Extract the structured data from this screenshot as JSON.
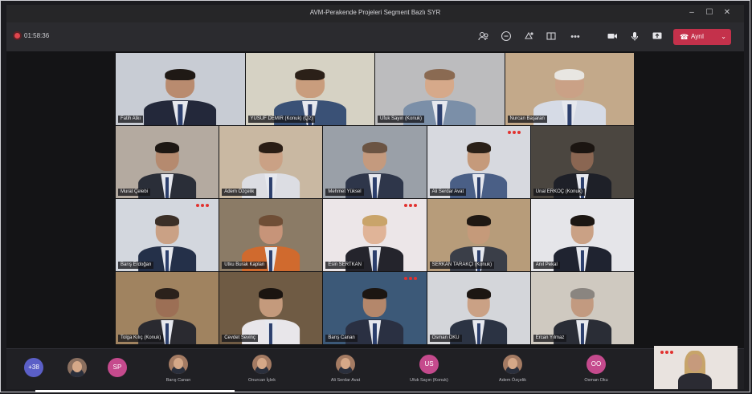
{
  "window": {
    "title": "AVM-Perakende Projeleri Segment Bazlı SYR",
    "controls": [
      "–",
      "☐",
      "✕"
    ]
  },
  "toolbar": {
    "timer": "01:58:36",
    "icons": [
      "participants-icon",
      "chat-icon",
      "reactions-icon",
      "rooms-icon",
      "more-icon",
      "camera-icon",
      "mic-icon",
      "share-icon"
    ],
    "leave_label": "Ayrıl"
  },
  "colors": {
    "leave_red": "#c4314b",
    "recording_red": "#e0464e",
    "overflow_purple": "#5b5fc7",
    "brand_red": "#e2322f"
  },
  "grid": {
    "tiles": [
      {
        "name": "Fatih Atkı",
        "bg": "#c8ccd4",
        "skin": "#b98b6f",
        "hair": "#1f1915",
        "suit": "#23283a"
      },
      {
        "name": "YUSUF DEMİR (Konuk) (Q2)",
        "bg": "#d6d2c4",
        "skin": "#c99d7d",
        "hair": "#2b2018",
        "suit": "#3a5176"
      },
      {
        "name": "Ufuk Sayın (Konuk)",
        "bg": "#bcbcbe",
        "skin": "#d6a98a",
        "hair": "#8a6a52",
        "suit": "#7b8fa8"
      },
      {
        "name": "Nurcan Başaran",
        "bg": "#c3a98a",
        "skin": "#caa186",
        "hair": "#e8e6e2",
        "suit": "#d6dbe6"
      },
      {
        "name": "Murat Çelebi",
        "bg": "#b4aaa0",
        "skin": "#b58a6f",
        "hair": "#1d1713",
        "suit": "#2a2e38"
      },
      {
        "name": "Adem Özçelik",
        "bg": "#c9b8a2",
        "skin": "#caa185",
        "hair": "#2a1d15",
        "suit": "#dcdde3"
      },
      {
        "name": "Mehmet Yüksel",
        "bg": "#9aa0a8",
        "skin": "#c49a7e",
        "hair": "#6b5443",
        "suit": "#2e364a"
      },
      {
        "name": "Ali Serdar Avat",
        "bg": "#d7d9df",
        "skin": "#c59a7b",
        "hair": "#2a2018",
        "suit": "#4a5f86"
      },
      {
        "name": "Ünal ERKOÇ (Konuk)",
        "bg": "#4b4640",
        "skin": "#8a6652",
        "hair": "#1b1511",
        "suit": "#1e2028"
      },
      {
        "name": "Barış Erdoğan",
        "bg": "#d3d7de",
        "skin": "#caa185",
        "hair": "#3b2f27",
        "suit": "#243049"
      },
      {
        "name": "Utku Burak Kaplan",
        "bg": "#8b7b66",
        "skin": "#c79479",
        "hair": "#6f4e36",
        "suit": "#d06a2e"
      },
      {
        "name": "Esin SERTKAN",
        "bg": "#ece6e8",
        "skin": "#e0b498",
        "hair": "#c9a46a",
        "suit": "#24242c"
      },
      {
        "name": "SERKAN TARAKÇI (Konuk)",
        "bg": "#b79c7a",
        "skin": "#c59a7a",
        "hair": "#1f1813",
        "suit": "#3a3e48"
      },
      {
        "name": "Anıl Pekal",
        "bg": "#e5e5e9",
        "skin": "#caa185",
        "hair": "#1c1612",
        "suit": "#1f2330"
      },
      {
        "name": "Tolga Kılıç (Konuk)",
        "bg": "#a08360",
        "skin": "#9c6f55",
        "hair": "#2b211b",
        "suit": "#2a2a30"
      },
      {
        "name": "Cevdet Sevinç",
        "bg": "#6f5b44",
        "skin": "#c49a7c",
        "hair": "#1a1410",
        "suit": "#e8e6ea"
      },
      {
        "name": "Barış Canan",
        "bg": "#3c5978",
        "skin": "#b4876b",
        "hair": "#1c1612",
        "suit": "#2a3042"
      },
      {
        "name": "Osman OKU",
        "bg": "#d4d6da",
        "skin": "#caa185",
        "hair": "#1c1612",
        "suit": "#2b3343"
      },
      {
        "name": "Ercan Yılmaz",
        "bg": "#cfc9c0",
        "skin": "#c29a80",
        "hair": "#8a8580",
        "suit": "#2a2d36"
      }
    ]
  },
  "tray": {
    "overflow_count": "+38",
    "avatars": [
      {
        "initials": "",
        "bg": "#8a6f5f"
      },
      {
        "initials": "SP",
        "bg": "#c54a8d"
      }
    ],
    "items": [
      {
        "name": "Barış Canan",
        "initials": "",
        "bg": "#a47b63"
      },
      {
        "name": "Onurcan İçlek",
        "initials": "",
        "bg": "#a47b63"
      },
      {
        "name": "Ali Serdar Avat",
        "initials": "",
        "bg": "#a47b63"
      },
      {
        "name": "Ufuk Sayın (Konuk)",
        "initials": "US",
        "bg": "#c54a8d"
      },
      {
        "name": "Adem Özçelik",
        "initials": "",
        "bg": "#a47b63"
      },
      {
        "name": "Osman Oku",
        "initials": "OO",
        "bg": "#c54a8d"
      }
    ]
  }
}
